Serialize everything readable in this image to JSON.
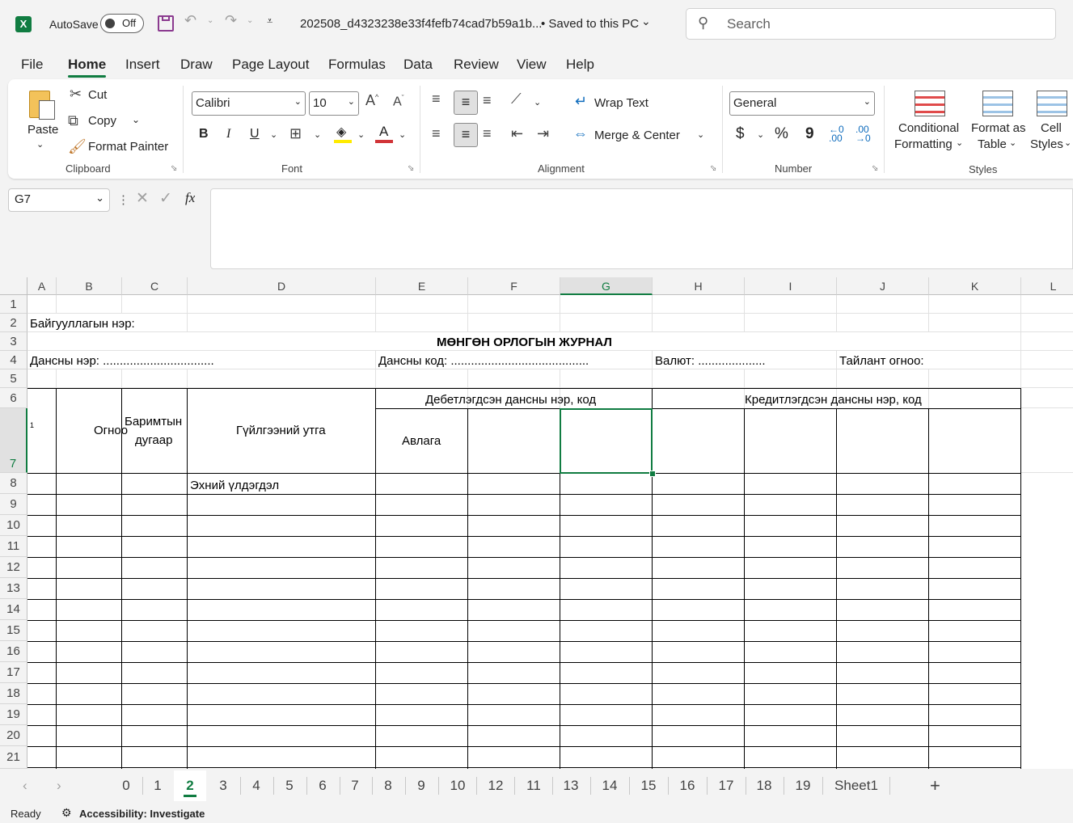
{
  "titlebar": {
    "autosave_label": "AutoSave",
    "autosave_state": "Off",
    "filename": "202508_d4323238e33f4fefb74cad7b59a1b...",
    "save_status": "• Saved to this PC",
    "search_placeholder": "Search"
  },
  "menu": [
    "File",
    "Home",
    "Insert",
    "Draw",
    "Page Layout",
    "Formulas",
    "Data",
    "Review",
    "View",
    "Help"
  ],
  "ribbon": {
    "clipboard": {
      "paste": "Paste",
      "cut": "Cut",
      "copy": "Copy",
      "format_painter": "Format Painter",
      "label": "Clipboard"
    },
    "font": {
      "name": "Calibri",
      "size": "10",
      "bold": "B",
      "italic": "I",
      "underline": "U",
      "label": "Font"
    },
    "alignment": {
      "wrap": "Wrap Text",
      "merge": "Merge & Center",
      "label": "Alignment"
    },
    "number": {
      "format": "General",
      "currency": "$",
      "percent": "%",
      "comma": "9",
      "label": "Number"
    },
    "styles": {
      "conditional_1": "Conditional",
      "conditional_2": "Formatting",
      "format_table_1": "Format as",
      "format_table_2": "Table",
      "cell_styles_1": "Cell",
      "cell_styles_2": "Styles",
      "label": "Styles"
    }
  },
  "formula_bar": {
    "name_box": "G7",
    "fx": "fx",
    "content": ""
  },
  "columns": [
    "A",
    "B",
    "C",
    "D",
    "E",
    "F",
    "G",
    "H",
    "I",
    "J",
    "K",
    "L"
  ],
  "rows": [
    "1",
    "2",
    "3",
    "4",
    "5",
    "6",
    "7",
    "8",
    "9",
    "10",
    "11",
    "12",
    "13",
    "14",
    "15",
    "16",
    "17",
    "18",
    "19",
    "20",
    "21"
  ],
  "cells": {
    "org_name": "Байгууллагын нэр:",
    "journal_title": "МӨНГӨН ОРЛОГЫН ЖУРНАЛ",
    "account_name": "Дансны нэр: .................................",
    "account_code": "Дансны код: .........................................",
    "currency": "Валют: ....................",
    "report_date": "Тайлант огноо:",
    "debit_header": "Дебетлэгдсэн дансны нэр, код",
    "credit_header": "Кредитлэгдсэн дансны нэр, код",
    "a7": "1",
    "date": "Огноо",
    "doc_no_1": "Баримтын",
    "doc_no_2": "дугаар",
    "transaction": "Гүйлгээний утга",
    "receivable": "Авлага",
    "opening_balance": "Эхний үлдэгдэл"
  },
  "sheet_tabs": [
    "0",
    "1",
    "2",
    "3",
    "4",
    "5",
    "6",
    "7",
    "8",
    "9",
    "10",
    "12",
    "11",
    "13",
    "14",
    "15",
    "16",
    "17",
    "18",
    "19",
    "Sheet1"
  ],
  "active_tab": "2",
  "status": {
    "ready": "Ready",
    "accessibility": "Accessibility: Investigate"
  },
  "colors": {
    "accent": "#107c41",
    "font_color": "#d13438",
    "highlight": "#ffeb00"
  }
}
